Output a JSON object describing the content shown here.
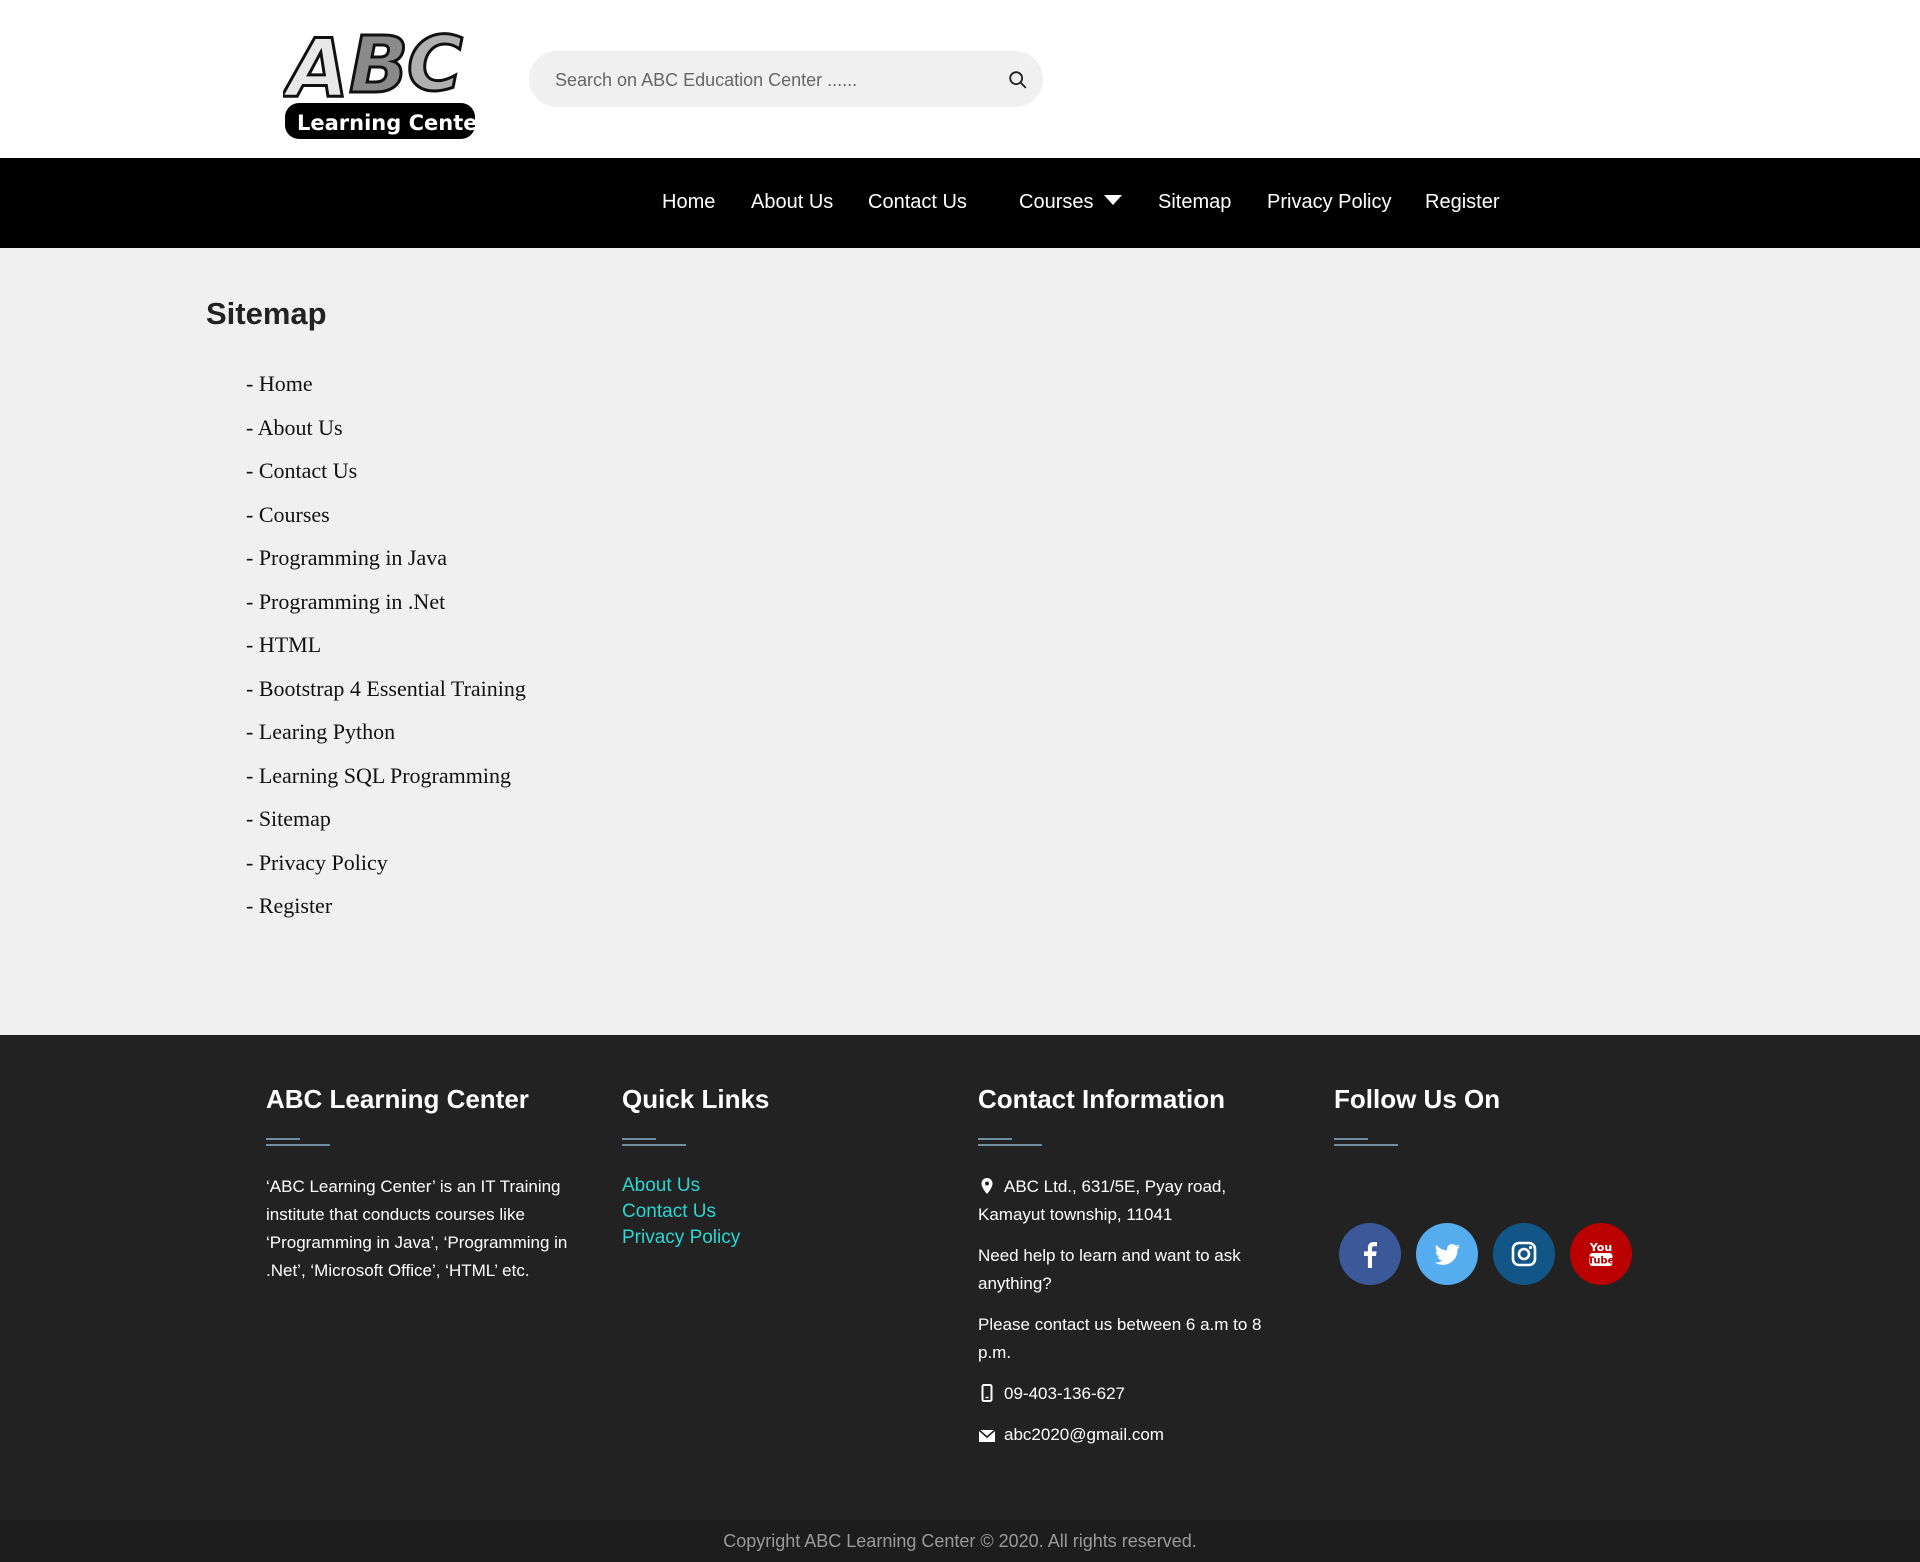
{
  "header": {
    "logo": {
      "title_text": "ABC",
      "subtitle_text": "Learning Center"
    },
    "search": {
      "placeholder": "Search on ABC Education Center ......"
    }
  },
  "nav": {
    "items": [
      {
        "label": "Home"
      },
      {
        "label": "About Us"
      },
      {
        "label": "Contact Us"
      },
      {
        "label": "Courses"
      },
      {
        "label": "Sitemap"
      },
      {
        "label": "Privacy Policy"
      },
      {
        "label": "Register"
      }
    ]
  },
  "main": {
    "title": "Sitemap",
    "links": [
      "- Home",
      "- About Us",
      "- Contact Us",
      "- Courses",
      "- Programming in Java",
      "- Programming in .Net",
      "- HTML",
      "- Bootstrap 4 Essential Training",
      "- Learing Python",
      "- Learning SQL Programming",
      "- Sitemap",
      "- Privacy Policy",
      "- Register"
    ]
  },
  "footer": {
    "about": {
      "heading": "ABC Learning Center",
      "text": "‘ABC Learning Center’ is an IT Training institute that conducts courses like ‘Programming in Java’, ‘Programming in .Net’, ‘Microsoft Office’, ‘HTML’ etc."
    },
    "quick_links": {
      "heading": "Quick Links",
      "links": [
        "About Us",
        "Contact Us",
        "Privacy Policy"
      ],
      "link_color": "#2bd6d2"
    },
    "contact": {
      "heading": "Contact Information",
      "address": "ABC Ltd., 631/5E, Pyay road, Kamayut township, 11041",
      "help": "Need help to learn and want to ask anything?",
      "hours": "Please contact us between 6 a.m to 8 p.m.",
      "phone": "09-403-136-627",
      "email": "abc2020@gmail.com"
    },
    "follow": {
      "heading": "Follow Us On",
      "networks": [
        {
          "icon": "facebook-icon",
          "color": "#3b5998"
        },
        {
          "icon": "twitter-icon",
          "color": "#55acee"
        },
        {
          "icon": "instagram-icon",
          "color": "#125688"
        },
        {
          "icon": "youtube-icon",
          "color": "#bb0000",
          "glyph_text": "You Tube"
        }
      ]
    }
  },
  "copyright": "Copyright  ABC Learning Center © 2020. All rights reserved."
}
